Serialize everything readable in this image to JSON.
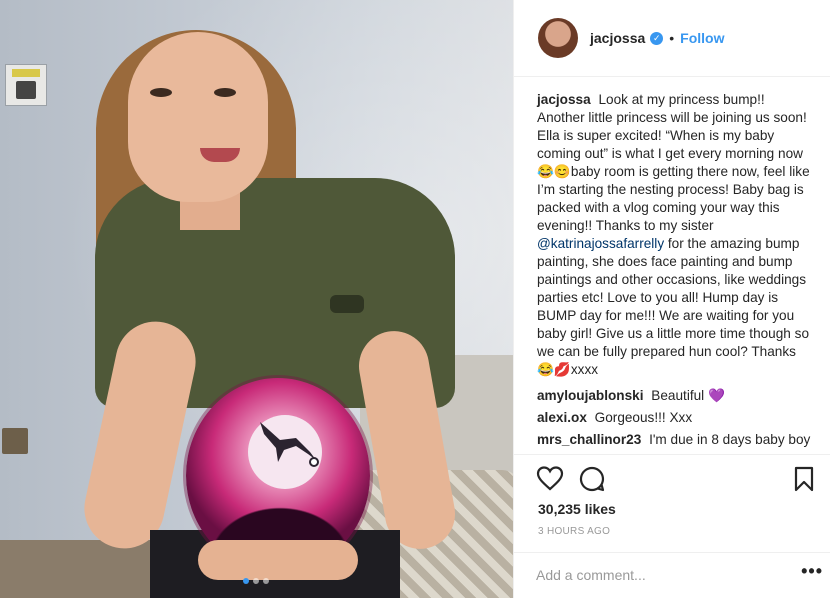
{
  "post": {
    "author": "jacjossa",
    "verified_badge": "✓",
    "separator": "•",
    "follow_label": "Follow",
    "photo_count": 3,
    "photo_index": 1
  },
  "caption": {
    "user": "jacjossa",
    "text_before_mention": "Look at my princess bump!! Another little princess will be joining us soon! Ella is super excited! “When is my baby coming out” is what I get every morning now 😂😊baby room is getting there now, feel like I’m starting the nesting process! Baby bag is packed with a vlog coming your way this evening!! Thanks to my sister",
    "mention": "@katrinajossafarrelly",
    "text_after_mention": "for the amazing bump painting, she does face painting and bump paintings and other occasions, like weddings parties etc! Love to you all! Hump day is BUMP day for me!!! We are waiting for you baby girl! Give us a little more time though so we can be fully prepared hun cool? Thanks 😂💋xxxx"
  },
  "comments": [
    {
      "user": "amyloujablonski",
      "text": "Beautiful 💜"
    },
    {
      "user": "alexi.ox",
      "text": "Gorgeous!!! Xxx"
    },
    {
      "user": "mrs_challinor23",
      "text": "I'm due in 8 days baby boy"
    }
  ],
  "stats": {
    "likes": "30,235 likes",
    "time": "3 HOURS AGO"
  },
  "add_comment": {
    "placeholder": "Add a comment...",
    "more": "•••"
  },
  "icons": [
    "heart-icon",
    "comment-icon",
    "bookmark-icon"
  ],
  "colors": {
    "link": "#3897f0",
    "mention": "#003569",
    "text": "#262626",
    "muted": "#999999"
  }
}
